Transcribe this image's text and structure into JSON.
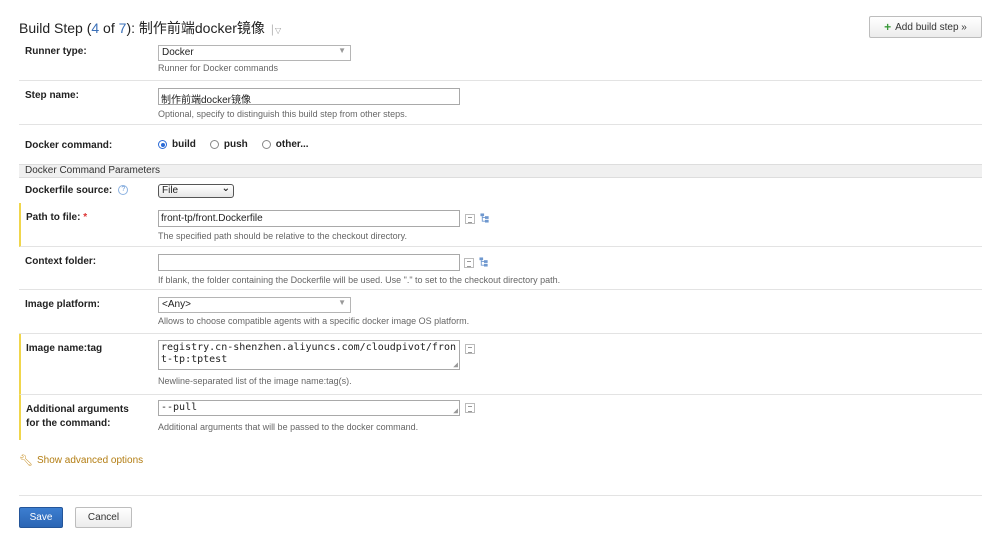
{
  "header": {
    "title_prefix": "Build Step (",
    "step_current": "4",
    "of_text": " of ",
    "step_total": "7",
    "title_suffix": "): 制作前端docker镜像",
    "add_button_label": "Add build step »"
  },
  "runner_type": {
    "label": "Runner type:",
    "value": "Docker",
    "hint": "Runner for Docker commands"
  },
  "step_name": {
    "label": "Step name:",
    "value": "制作前端docker镜像",
    "hint": "Optional, specify to distinguish this build step from other steps."
  },
  "docker_command": {
    "label": "Docker command:",
    "options": [
      "build",
      "push",
      "other..."
    ],
    "selected": "build"
  },
  "section_title": "Docker Command Parameters",
  "dockerfile_source": {
    "label": "Dockerfile source:",
    "value": "File"
  },
  "path_to_file": {
    "label": "Path to file:",
    "required_mark": "*",
    "value": "front-tp/front.Dockerfile",
    "hint": "The specified path should be relative to the checkout directory."
  },
  "context_folder": {
    "label": "Context folder:",
    "value": "",
    "hint": "If blank, the folder containing the Dockerfile will be used. Use \".\" to set to the checkout directory path."
  },
  "image_platform": {
    "label": "Image platform:",
    "value": "<Any>",
    "hint": "Allows to choose compatible agents with a specific docker image OS platform."
  },
  "image_name_tag": {
    "label": "Image name:tag",
    "value": "registry.cn-shenzhen.aliyuncs.com/cloudpivot/front-tp:tptest",
    "hint": "Newline-separated list of the image name:tag(s)."
  },
  "additional_args": {
    "label_line1": "Additional arguments",
    "label_line2": "for the command:",
    "value": "--pull",
    "hint": "Additional arguments that will be passed to the docker command."
  },
  "advanced_link": "Show advanced options",
  "footer": {
    "save_label": "Save",
    "cancel_label": "Cancel"
  },
  "colors": {
    "accent": "#2b65b4",
    "required_bar": "#f0d64c",
    "link": "#b37d12"
  }
}
